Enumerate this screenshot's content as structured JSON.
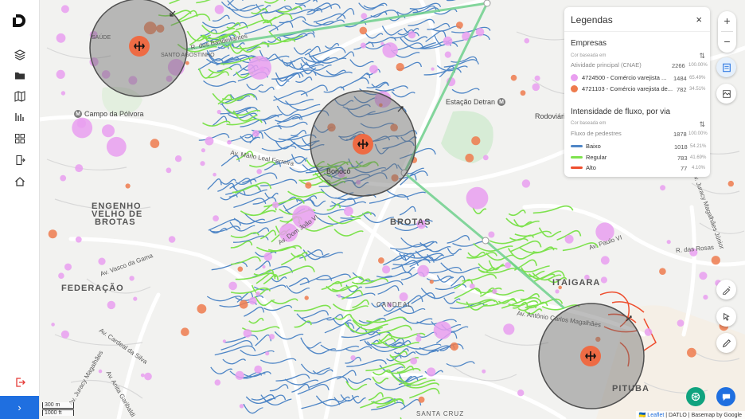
{
  "sidebar": {
    "items": [
      {
        "name": "layers-icon"
      },
      {
        "name": "folder-icon"
      },
      {
        "name": "map-icon"
      },
      {
        "name": "chart-icon"
      },
      {
        "name": "grid-icon"
      },
      {
        "name": "export-icon"
      },
      {
        "name": "home-icon"
      }
    ],
    "expand_label": "›"
  },
  "legend": {
    "title": "Legendas",
    "close": "×",
    "empresas": {
      "title": "Empresas",
      "color_based_label": "Cor baseada em",
      "attribute": "Atividade principal (CNAE)",
      "total": "2266",
      "total_pct": "100.00%",
      "rows": [
        {
          "color": "#e99ff0",
          "label": "4724500 - Comércio varejista ...",
          "value": "1484",
          "pct": "65.49%"
        },
        {
          "color": "#ee7b4d",
          "label": "4721103 - Comércio varejista de...",
          "value": "782",
          "pct": "34.51%"
        }
      ]
    },
    "fluxo": {
      "title": "Intensidade de fluxo, por via",
      "color_based_label": "Cor baseada em",
      "attribute": "Fluxo de pedestres",
      "total": "1878",
      "total_pct": "100.00%",
      "rows": [
        {
          "color": "#4f86c6",
          "label": "Baixo",
          "value": "1018",
          "pct": "54.21%"
        },
        {
          "color": "#7ee24e",
          "label": "Regular",
          "value": "783",
          "pct": "41.69%"
        },
        {
          "color": "#ee4e2e",
          "label": "Alto",
          "value": "77",
          "pct": "4.10%"
        }
      ]
    }
  },
  "zoom": {
    "in": "+",
    "out": "−"
  },
  "map_labels": {
    "saude": "SAÚDE",
    "santo_agostinho": "SANTO AGOSTINHO",
    "campo_polvora": "Campo da Pólvora",
    "estacao_detran": "Estação Detran",
    "rodoviaria": "Rodoviária",
    "engenho": "ENGENHO",
    "velho_de": "VELHO DE",
    "brotas_w": "BROTAS",
    "brotas": "BROTAS",
    "federacao": "FEDERAÇÃO",
    "itaigara": "ITAIGARA",
    "pituba": "PITUBA",
    "candeal": "CANDEAL",
    "bonoco": "Bonocô",
    "santa_cruz": "SANTA CRUZ",
    "r_bandeirantes": "R. dos Bandeirantes",
    "av_mario_leal": "Av. Mário Leal Ferreira",
    "av_paulo_vi": "Av. Paulo VI",
    "av_antonio_carlos": "Av. Antônio Carlos Magalhães",
    "av_vasco": "Av. Vasco da Gama",
    "av_dom_joao": "Av. Dom João VI",
    "av_cardeal": "Av. Cardeal da Silva",
    "av_juracy": "Av. Juracy Magalhães Júnior",
    "r_das_rosas": "R. das Rosas",
    "av_garibaldi": "Av. Anita Garibaldi",
    "av_joao_lima": "Av. Juracy Magalhães"
  },
  "scale": {
    "metric": "300 m",
    "imperial": "1000 ft"
  },
  "attribution": {
    "leaflet": "Leaflet",
    "rest": "| DATLO | Basemap by Google"
  },
  "colors": {
    "accent": "#1f6fe0",
    "baixo": "#4f86c6",
    "regular": "#7ee24e",
    "alto": "#ee4e2e",
    "empresa_rosa": "#e99ff0",
    "empresa_laranja": "#ee7b4d"
  }
}
